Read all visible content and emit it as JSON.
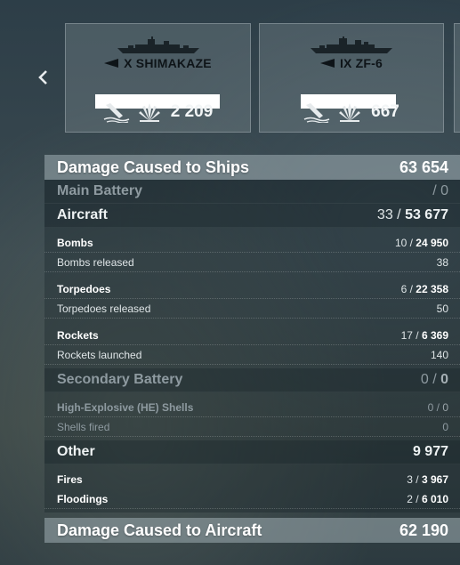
{
  "carousel": {
    "prev_icon": "chevron-left-icon",
    "ships": [
      {
        "name": "X SHIMAKAZE",
        "tier_flag_icon": "nation-flag-icon",
        "kills_icon": "sunk-ship-icon",
        "damage_icon": "explosion-icon",
        "value": "2 209"
      },
      {
        "name": "IX ZF-6",
        "tier_flag_icon": "nation-flag-icon",
        "kills_icon": "sunk-ship-icon",
        "damage_icon": "explosion-icon",
        "value": "667"
      }
    ]
  },
  "damage_to_ships": {
    "label": "Damage Caused to Ships",
    "value": "63 654",
    "main_battery": {
      "label": "Main Battery",
      "value": "/ 0"
    },
    "aircraft": {
      "label": "Aircraft",
      "hits": "33 /",
      "value": "53 677",
      "bombs": {
        "label": "Bombs",
        "hits": "10 /",
        "value": "24 950",
        "released_label": "Bombs released",
        "released": "38"
      },
      "torpedoes": {
        "label": "Torpedoes",
        "hits": "6 /",
        "value": "22 358",
        "released_label": "Torpedoes released",
        "released": "50"
      },
      "rockets": {
        "label": "Rockets",
        "hits": "17 /",
        "value": "6 369",
        "launched_label": "Rockets launched",
        "launched": "140"
      }
    },
    "secondary": {
      "label": "Secondary Battery",
      "hits": "0 /",
      "value": "0",
      "he": {
        "label": "High-Explosive (HE) Shells",
        "hits": "0 /",
        "value": "0",
        "fired_label": "Shells fired",
        "fired": "0"
      }
    },
    "other": {
      "label": "Other",
      "value": "9 977",
      "fires": {
        "label": "Fires",
        "hits": "3 /",
        "value": "3 967"
      },
      "floodings": {
        "label": "Floodings",
        "hits": "2 /",
        "value": "6 010"
      }
    }
  },
  "damage_to_aircraft": {
    "label": "Damage Caused to Aircraft",
    "value": "62 190"
  }
}
